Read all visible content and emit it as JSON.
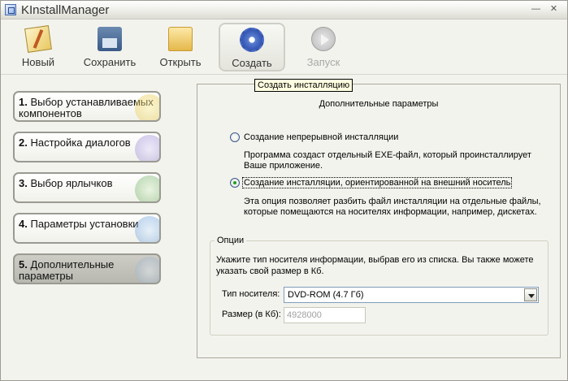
{
  "window": {
    "title": "KInstallManager"
  },
  "toolbar": {
    "new_label": "Новый",
    "save_label": "Сохранить",
    "open_label": "Открыть",
    "create_label": "Создать",
    "run_label": "Запуск"
  },
  "tooltip": "Создать инсталляцию",
  "steps": [
    {
      "num": "1.",
      "label": "Выбор устанавливаемых компонентов"
    },
    {
      "num": "2.",
      "label": "Настройка диалогов"
    },
    {
      "num": "3.",
      "label": "Выбор ярлычков"
    },
    {
      "num": "4.",
      "label": "Параметры установки"
    },
    {
      "num": "5.",
      "label": "Дополнительные параметры"
    }
  ],
  "panel": {
    "title": "Дополнительные параметры",
    "option1": {
      "label": "Создание непрерывной инсталляции",
      "desc": "Программа создаст отдельный EXE-файл, который проинсталлирует Ваше приложение.",
      "checked": false
    },
    "option2": {
      "label": "Создание инсталляции, ориентированной на внешний носитель",
      "desc": "Эта опция позволяет разбить файл инсталляции на отдельные файлы, которые помещаются на носителях информации, например, дискетах.",
      "checked": true
    },
    "options_group": {
      "legend": "Опции",
      "text": "Укажите тип носителя информации, выбрав его из списка. Вы также можете указать свой размер в Кб.",
      "media_label": "Тип носителя:",
      "media_value": "DVD-ROM (4.7 Гб)",
      "size_label": "Размер (в Кб):",
      "size_value": "4928000"
    }
  }
}
